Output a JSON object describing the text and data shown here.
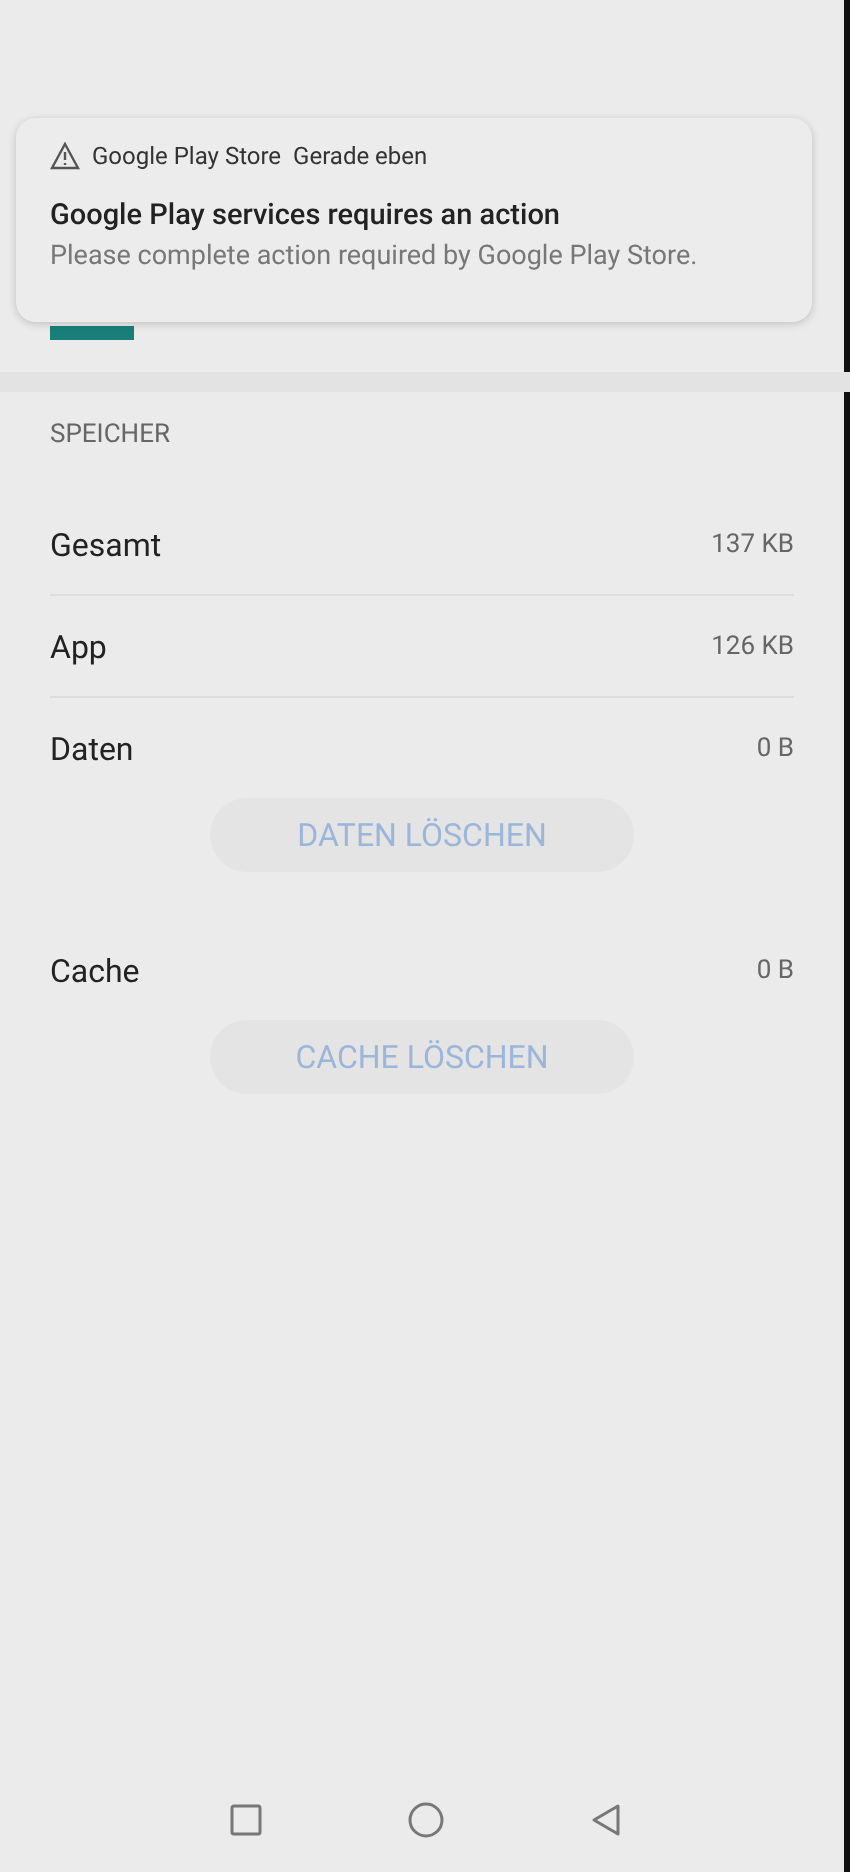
{
  "notification": {
    "app": "Google Play Store",
    "time": "Gerade eben",
    "title": "Google Play services requires an action",
    "text": "Please complete action required by Google Play Store."
  },
  "storage": {
    "heading": "SPEICHER",
    "rows": [
      {
        "kind": "row",
        "label": "Gesamt",
        "value": "137 KB"
      },
      {
        "kind": "row",
        "label": "App",
        "value": "126 KB"
      },
      {
        "kind": "row",
        "label": "Daten",
        "value": "0 B"
      },
      {
        "kind": "button",
        "label": "DATEN LÖSCHEN"
      },
      {
        "kind": "row",
        "label": "Cache",
        "value": "0 B"
      },
      {
        "kind": "button",
        "label": "CACHE LÖSCHEN"
      }
    ]
  }
}
